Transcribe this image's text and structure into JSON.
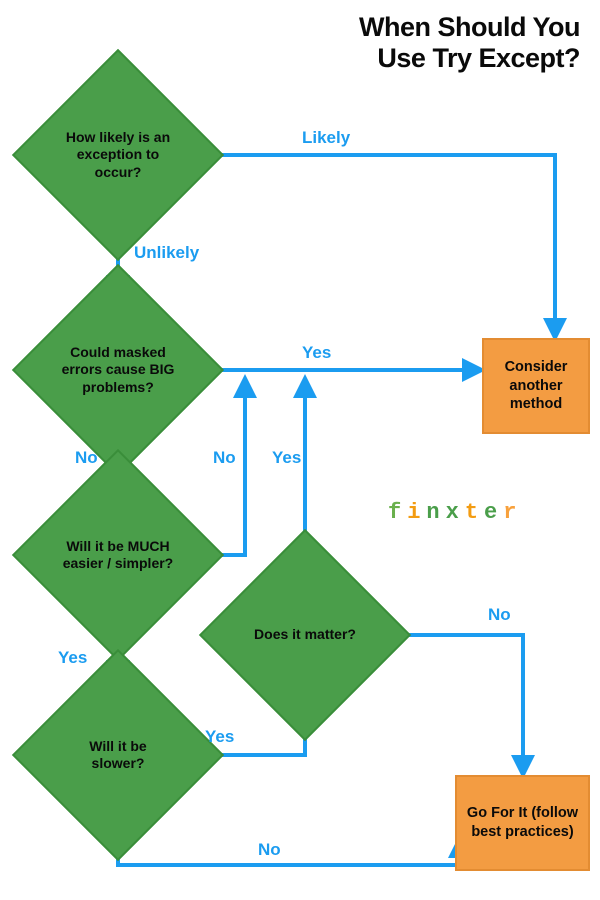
{
  "title_l1": "When Should You",
  "title_l2": "Use Try Except?",
  "diamonds": {
    "d1": "How likely is an exception to occur?",
    "d2": "Could masked errors cause BIG problems?",
    "d3": "Will it be MUCH easier / simpler?",
    "d4": "Will it be slower?",
    "d5": "Does it matter?"
  },
  "boxes": {
    "b1": "Consider another method",
    "b2": "Go For It (follow best practices)"
  },
  "labels": {
    "likely": "Likely",
    "unlikely": "Unlikely",
    "yes1": "Yes",
    "no1": "No",
    "no2": "No",
    "yes2": "Yes",
    "yes3": "Yes",
    "yes4": "Yes",
    "no3": "No",
    "no4": "No"
  },
  "brand": "finxter"
}
